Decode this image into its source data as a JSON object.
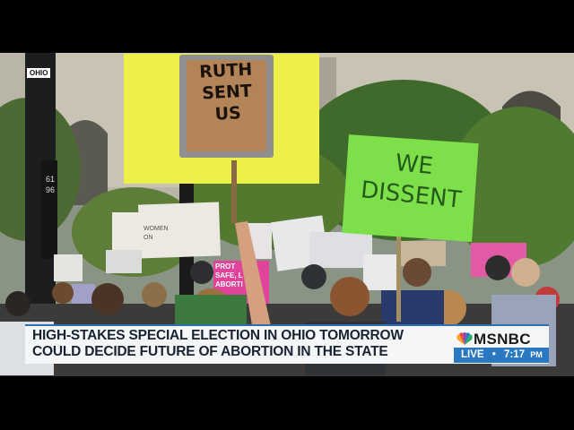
{
  "location_bug": "OHIO",
  "signs": {
    "ruth": [
      "RUTH",
      "SENT",
      "US"
    ],
    "dissent": [
      "WE",
      "DISSENT"
    ],
    "pink": [
      "PROT",
      "SAFE, L",
      "ABORTI"
    ],
    "women": [
      "WOMEN",
      "ON"
    ]
  },
  "pole_numbers": "6196",
  "lower_third": {
    "headline": "HIGH-STAKES SPECIAL ELECTION IN OHIO TOMORROW COULD DECIDE FUTURE OF ABORTION IN THE STATE",
    "network": "MSNBC",
    "live": "LIVE",
    "separator": "•",
    "time": "7:17",
    "period": "PM"
  },
  "colors": {
    "accent": "#2a78c2",
    "sign_yellow": "#eef04a",
    "sign_green": "#7de04a",
    "sign_pink": "#e0449a"
  }
}
